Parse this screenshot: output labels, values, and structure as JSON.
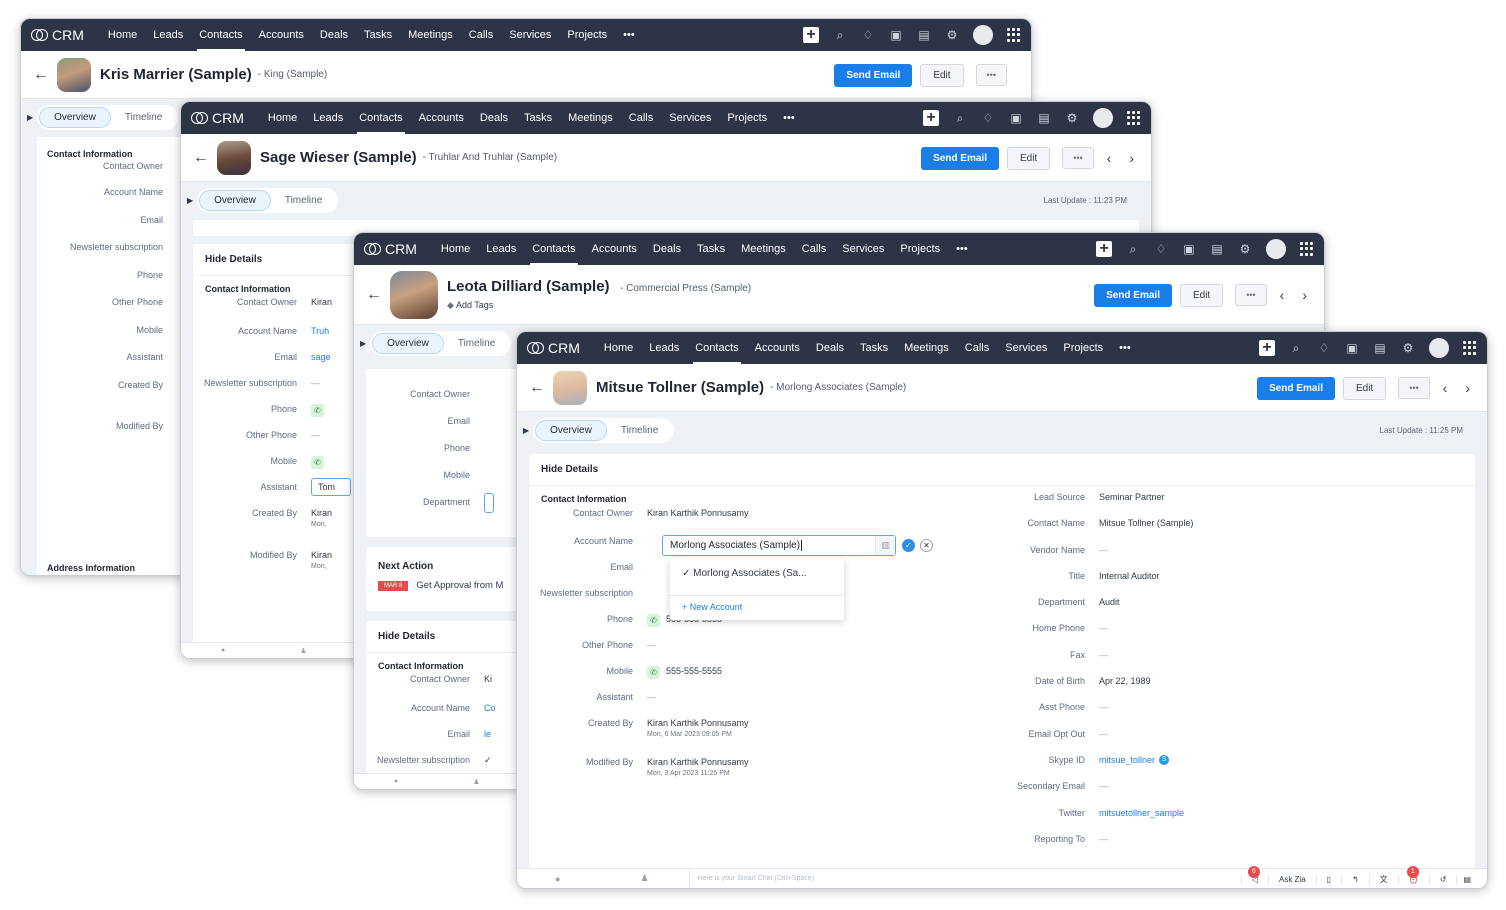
{
  "nav": {
    "brand": "CRM",
    "items": [
      "Home",
      "Leads",
      "Contacts",
      "Accounts",
      "Deals",
      "Tasks",
      "Meetings",
      "Calls",
      "Services",
      "Projects",
      "•••"
    ],
    "active": "Contacts"
  },
  "actions": {
    "send_email": "Send Email",
    "edit": "Edit",
    "more": "•••",
    "prev": "‹",
    "next": "›"
  },
  "tabs": {
    "overview": "Overview",
    "timeline": "Timeline"
  },
  "windows": {
    "w1": {
      "name": "Kris Marrier (Sample)",
      "sub": "- King (Sample)",
      "section": "Contact Information",
      "labels": [
        "Contact Owner",
        "Account Name",
        "Email",
        "Newsletter subscription",
        "Phone",
        "Other Phone",
        "Mobile",
        "Assistant",
        "Created By",
        "Modified By"
      ],
      "address": "Address Information"
    },
    "w2": {
      "name": "Sage Wieser (Sample)",
      "sub": "- Truhlar And Truhlar (Sample)",
      "last_update": "Last Update : 11:23 PM",
      "hide_details": "Hide Details",
      "section": "Contact Information",
      "fields": [
        {
          "label": "Contact Owner",
          "value": "Kiran"
        },
        {
          "label": "Account Name",
          "value": "Truh"
        },
        {
          "label": "Email",
          "value": "sage"
        },
        {
          "label": "Newsletter subscription",
          "value": "—"
        },
        {
          "label": "Phone",
          "value": ""
        },
        {
          "label": "Other Phone",
          "value": "—"
        },
        {
          "label": "Mobile",
          "value": ""
        },
        {
          "label": "Assistant",
          "value": "Tom"
        },
        {
          "label": "Created By",
          "value": "Kiran",
          "sub": "Mon,"
        },
        {
          "label": "Modified By",
          "value": "Kiran",
          "sub": "Mon,"
        }
      ]
    },
    "w3": {
      "name": "Leota Dilliard (Sample)",
      "sub": "- Commercial Press (Sample)",
      "add_tags": "Add Tags",
      "summary_fields": [
        "Contact Owner",
        "Email",
        "Phone",
        "Mobile",
        "Department"
      ],
      "next_action": {
        "title": "Next Action",
        "date": "MAR 8",
        "text": "Get Approval from M"
      },
      "hide_details": "Hide Details",
      "section": "Contact Information",
      "fields": [
        {
          "label": "Contact Owner",
          "value": "Ki"
        },
        {
          "label": "Account Name",
          "value": "Co"
        },
        {
          "label": "Email",
          "value": "le"
        },
        {
          "label": "Newsletter subscription",
          "value": "✓"
        }
      ]
    },
    "w4": {
      "name": "Mitsue Tollner (Sample)",
      "sub": "- Morlong Associates (Sample)",
      "last_update": "Last Update : 11:25 PM",
      "hide_details": "Hide Details",
      "section": "Contact Information",
      "account_input_value": "Morlong Associates (Sample)",
      "dropdown_option": "✓ Morlong Associates (Sa...",
      "dropdown_new": "+ New Account",
      "left_fields": [
        {
          "label": "Contact Owner",
          "value": "Kiran Karthik Ponnusamy"
        },
        {
          "label": "Account Name",
          "value": ""
        },
        {
          "label": "Email",
          "value": ""
        },
        {
          "label": "Newsletter subscription",
          "value": ""
        },
        {
          "label": "Phone",
          "value": "555-555-5555"
        },
        {
          "label": "Other Phone",
          "value": "—"
        },
        {
          "label": "Mobile",
          "value": "555-555-5555"
        },
        {
          "label": "Assistant",
          "value": "—"
        },
        {
          "label": "Created By",
          "value": "Kiran Karthik Ponnusamy",
          "sub": "Mon, 6 Mar 2023 09:05 PM"
        },
        {
          "label": "Modified By",
          "value": "Kiran Karthik Ponnusamy",
          "sub": "Mon, 3 Apr 2023 11:25 PM"
        }
      ],
      "right_fields": [
        {
          "label": "Lead Source",
          "value": "Seminar Partner"
        },
        {
          "label": "Contact Name",
          "value": "Mitsue Tollner (Sample)"
        },
        {
          "label": "Vendor Name",
          "value": "—"
        },
        {
          "label": "Title",
          "value": "Internal Auditor"
        },
        {
          "label": "Department",
          "value": "Audit"
        },
        {
          "label": "Home Phone",
          "value": "—"
        },
        {
          "label": "Fax",
          "value": "—"
        },
        {
          "label": "Date of Birth",
          "value": "Apr 22, 1989"
        },
        {
          "label": "Asst Phone",
          "value": "—"
        },
        {
          "label": "Email Opt Out",
          "value": "—"
        },
        {
          "label": "Skype ID",
          "value": "mitsue_tollner"
        },
        {
          "label": "Secondary Email",
          "value": "—"
        },
        {
          "label": "Twitter",
          "value": "mitsuetollner_sample"
        },
        {
          "label": "Reporting To",
          "value": "—"
        }
      ],
      "smart_chat_placeholder": "Here is your Smart Chat (Ctrl+Space)",
      "ask_zia": "Ask Zia",
      "badge_announce": "6",
      "badge_alarm": "1"
    }
  }
}
